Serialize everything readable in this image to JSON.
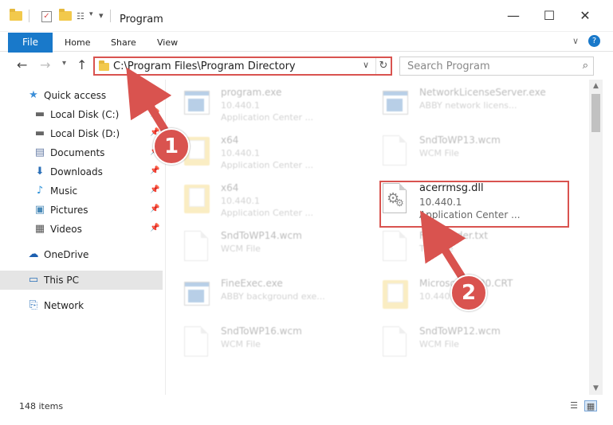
{
  "window": {
    "title": "Program",
    "minimize": "—",
    "maximize": "☐",
    "close": "✕"
  },
  "ribbon": {
    "file_tab": "File",
    "tabs": [
      "Home",
      "Share",
      "View"
    ],
    "expand_icon": "chevron-down-icon",
    "help_icon": "help-icon"
  },
  "address": {
    "path": "C:\\Program Files\\Program Directory",
    "search_placeholder": "Search Program"
  },
  "sidebar": {
    "items": [
      {
        "label": "Quick access",
        "icon": "star-icon",
        "pinned": false
      },
      {
        "label": "Local Disk (C:)",
        "icon": "drive-icon",
        "pinned": true
      },
      {
        "label": "Local Disk (D:)",
        "icon": "drive-icon",
        "pinned": true
      },
      {
        "label": "Documents",
        "icon": "documents-icon",
        "pinned": true
      },
      {
        "label": "Downloads",
        "icon": "download-icon",
        "pinned": true
      },
      {
        "label": "Music",
        "icon": "music-icon",
        "pinned": true
      },
      {
        "label": "Pictures",
        "icon": "pictures-icon",
        "pinned": true
      },
      {
        "label": "Videos",
        "icon": "videos-icon",
        "pinned": true
      },
      {
        "label": "OneDrive",
        "icon": "cloud-icon",
        "pinned": false
      },
      {
        "label": "This PC",
        "icon": "computer-icon",
        "pinned": false,
        "selected": true
      },
      {
        "label": "Network",
        "icon": "network-icon",
        "pinned": false
      }
    ]
  },
  "files": [
    {
      "name": "program.exe",
      "version": "10.440.1",
      "type": "Application Center ...",
      "kind": "exe"
    },
    {
      "name": "NetworkLicenseServer.exe",
      "version": "ABBY network licens...",
      "type": "",
      "kind": "exe"
    },
    {
      "name": "x64",
      "version": "10.440.1",
      "type": "Application Center ...",
      "kind": "folder"
    },
    {
      "name": "SndToWP13.wcm",
      "version": "WCM File",
      "type": "",
      "kind": "doc"
    },
    {
      "name": "x64",
      "version": "10.440.1",
      "type": "Application Center ...",
      "kind": "folder"
    },
    {
      "name": "acerrmsg.dll",
      "version": "10.440.1",
      "type": "Application Center ...",
      "kind": "dll"
    },
    {
      "name": "SndToWP14.wcm",
      "version": "WCM File",
      "type": "",
      "kind": "doc"
    },
    {
      "name": "FineReader.txt",
      "version": "TXT File",
      "type": "",
      "kind": "doc"
    },
    {
      "name": "FineExec.exe",
      "version": "ABBY background exe...",
      "type": "",
      "kind": "exe"
    },
    {
      "name": "Microsoft.VC90.CRT",
      "version": "10.440.1",
      "type": "",
      "kind": "folder"
    },
    {
      "name": "SndToWP16.wcm",
      "version": "WCM File",
      "type": "",
      "kind": "doc"
    },
    {
      "name": "SndToWP12.wcm",
      "version": "WCM File",
      "type": "",
      "kind": "doc"
    }
  ],
  "status": {
    "item_count": "148 items"
  },
  "callouts": {
    "step1": "1",
    "step2": "2"
  },
  "colors": {
    "accent": "#1979ca",
    "highlight": "#d9534f"
  }
}
